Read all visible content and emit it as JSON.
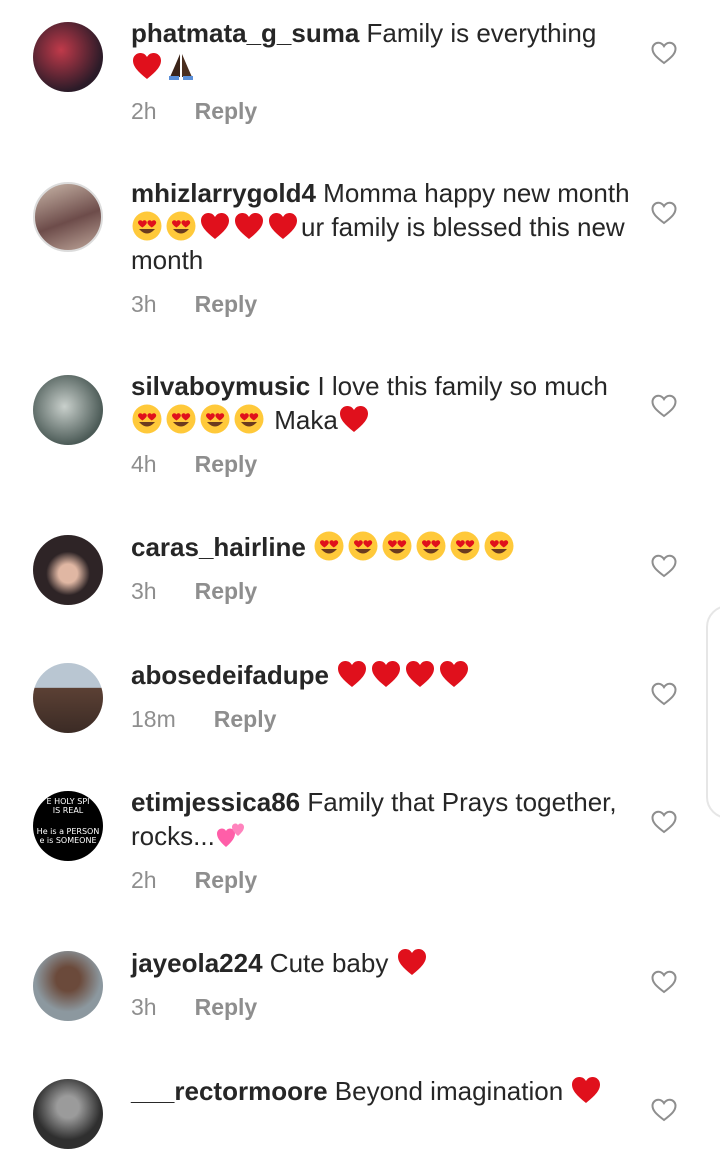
{
  "comments": [
    {
      "username": "phatmata_g_suma",
      "text": "Family is everything",
      "emojis_after": [
        "heart",
        "pray"
      ],
      "time": "2h",
      "reply": "Reply",
      "avatar_color": "#5a2f3c"
    },
    {
      "username": "mhizlarrygold4",
      "text_before": "Momma happy new month",
      "emojis_mid": [
        "heart-eyes",
        "heart-eyes",
        "heart",
        "heart",
        "heart"
      ],
      "text_after": "ur family is blessed this new month",
      "time": "3h",
      "reply": "Reply",
      "avatar_color": "#8a6a68"
    },
    {
      "username": "silvaboymusic",
      "text_before": "I love this family so much",
      "emojis_mid": [
        "heart-eyes",
        "heart-eyes",
        "heart-eyes",
        "heart-eyes"
      ],
      "text_after": "Maka",
      "emojis_after": [
        "heart"
      ],
      "time": "4h",
      "reply": "Reply",
      "avatar_color": "#4c5b57"
    },
    {
      "username": "caras_hairline",
      "emojis_after": [
        "heart-eyes",
        "heart-eyes",
        "heart-eyes",
        "heart-eyes",
        "heart-eyes",
        "heart-eyes"
      ],
      "time": "3h",
      "reply": "Reply",
      "avatar_color": "#2e2426"
    },
    {
      "username": "abosedeifadupe",
      "emojis_after": [
        "heart",
        "heart",
        "heart",
        "heart"
      ],
      "time": "18m",
      "reply": "Reply",
      "avatar_color": "#6e7a86"
    },
    {
      "username": "etimjessica86",
      "text": "Family that Prays together, rocks...",
      "emojis_after": [
        "two-hearts"
      ],
      "time": "2h",
      "reply": "Reply",
      "avatar_color": "#000000",
      "avatar_text": {
        "line1": "E HOLY SPI",
        "line2": "IS REAL",
        "line3": "He is a PERSON",
        "line4": "e is SOMEONE"
      }
    },
    {
      "username": "jayeola224",
      "text": "Cute baby",
      "emojis_after": [
        "heart"
      ],
      "time": "3h",
      "reply": "Reply",
      "avatar_color": "#7d8a93"
    },
    {
      "username": "___rectormoore",
      "text": "Beyond imagination",
      "emojis_after": [
        "heart"
      ],
      "time": "",
      "reply": "",
      "avatar_color": "#3a3a3a"
    }
  ],
  "colors": {
    "text": "#262626",
    "meta": "#8e8e8e",
    "heart": "#e0101c",
    "emoji_face": "#ffc93a"
  }
}
